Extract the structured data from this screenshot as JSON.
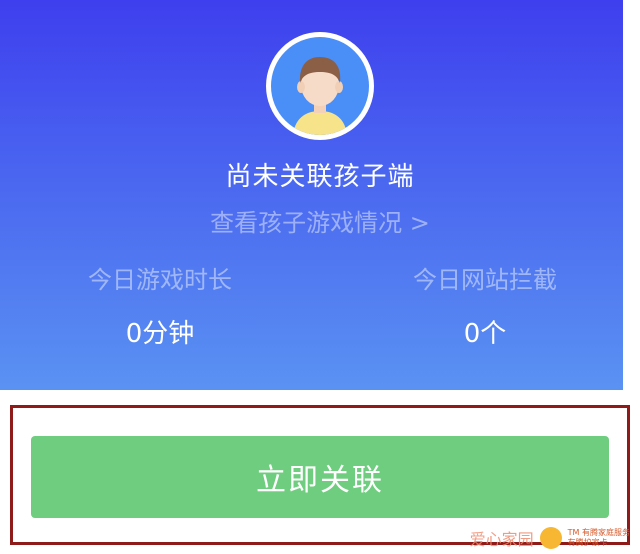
{
  "header": {
    "link_status": "尚未关联孩子端",
    "view_child": "查看孩子游戏情况 >"
  },
  "stats": {
    "game_time_label": "今日游戏时长",
    "game_time_value": "0分钟",
    "site_block_label": "今日网站拦截",
    "site_block_value": "0个"
  },
  "action": {
    "link_button_label": "立即关联"
  },
  "watermark": {
    "text": "爱心家园",
    "tag": "TM 有腾家庭服务",
    "tag2": "有腾护家卡"
  },
  "colors": {
    "gradient_top": "#3e3fee",
    "gradient_bottom": "#5a92f2",
    "button": "#6fcd7f",
    "highlight_border": "#8e1a1a"
  }
}
